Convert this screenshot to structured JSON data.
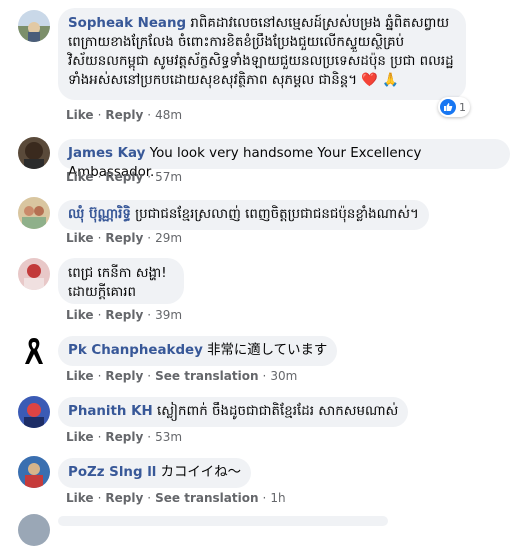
{
  "action_labels": {
    "like": "Like",
    "reply": "Reply",
    "translate": "See translation"
  },
  "comments": [
    {
      "author": "Sopheak Neang",
      "text": "រាពិគដាវលេចនៅសម្មេសដ៍ស្រស់បម្រង ឆ្នំពិតសព្វាយ ពេក្រាយខាងក្រែលែង ចំពោះការខិតខំប្រឹងប្រែងជួយលើកស្ទួយស្ថិគ្រប់ វិស័យនលកម្ពុជា សូមវត្តស័ក្ខសិទ្ធទាំងឡាយជួយនលប្រទេសដប៉ុន ប្រជា ពលរដ្ឋទាំងអស់សនៅប្រកបដោយសុខសុវត្ថិភាព សុភម្គល ជានិន្ត។ ❤️ 🙏",
      "reactions": "1",
      "time": "48m"
    },
    {
      "author": "James Kay",
      "text": "You look very handsome Your Excellency Ambassador.",
      "time": "57m"
    },
    {
      "author": "ឈុំ ប៊ុណ្ណារិទ្ធិ",
      "text": "ប្រជាជនខ្មែរស្រលាញ់ ពេញចិត្តប្រជាជនជប៉ុនខ្លាំងណាស់។",
      "time": "29m"
    },
    {
      "author": "ពេជ្រ កេនីកា សង្ហា!",
      "text": "ដោយក្តីគោរព",
      "time": "39m"
    },
    {
      "author": "Pk Chanpheakdey",
      "text": "非常に適しています",
      "time": "30m"
    },
    {
      "author": "Phanith KH",
      "text": "ស្លៀកពាក់ ចឹងដូចជាជាតិខ្មែរដែរ សាកសមណាស់",
      "time": "53m"
    },
    {
      "author": "PoZz Slng ll",
      "text": "カコイイね〜",
      "time": "1h"
    }
  ]
}
